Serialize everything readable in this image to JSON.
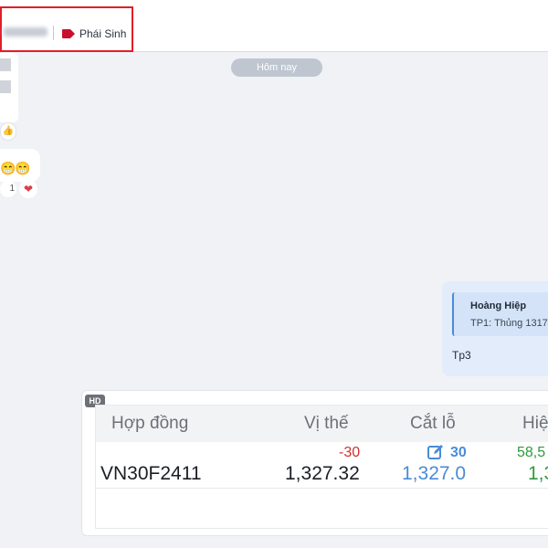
{
  "header": {
    "tag_label": "Phái Sinh",
    "tag_color": "#c8102e",
    "highlight_color": "#e01e27"
  },
  "left_column": {
    "like_icon": "thumbs-up-icon",
    "emojis": [
      "😁",
      "😁"
    ],
    "reaction_count": "1",
    "reaction_icon": "heart-icon"
  },
  "date_divider": "Hôm nay",
  "message": {
    "quote_author": "Hoàng Hiệp",
    "quote_text": "TP1: Thủng 1317",
    "text": "Tp3"
  },
  "card": {
    "badge": "HD",
    "table": {
      "headers": [
        "Hợp đồng",
        "Vị thế",
        "Cắt lỗ",
        "Hiệ"
      ],
      "row": {
        "contract": "VN30F2411",
        "position_change": "-30",
        "position_value": "1,327.32",
        "stoploss_change": "30",
        "stoploss_value": "1,327.0",
        "profit_change": "58,5",
        "profit_value": "1,3"
      },
      "colors": {
        "negative": "#d0312d",
        "edit": "#4a8bd6",
        "positive": "#2e9a3c"
      }
    }
  }
}
